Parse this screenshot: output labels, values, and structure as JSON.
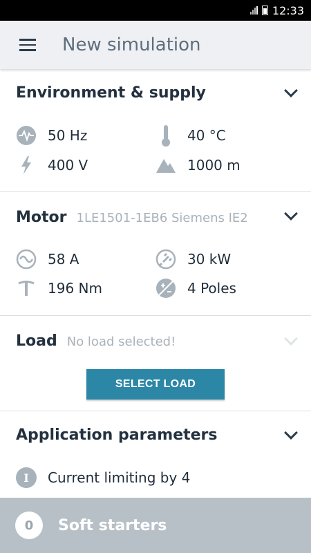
{
  "status_bar": {
    "time": "12:33"
  },
  "app_bar": {
    "title": "New simulation",
    "menu_icon": "hamburger-menu-icon"
  },
  "environment": {
    "title": "Environment & supply",
    "items": [
      {
        "icon": "frequency-icon",
        "value": "50 Hz"
      },
      {
        "icon": "thermometer-icon",
        "value": "40 °C"
      },
      {
        "icon": "voltage-bolt-icon",
        "value": "400 V"
      },
      {
        "icon": "altitude-mountain-icon",
        "value": "1000 m"
      }
    ]
  },
  "motor": {
    "title": "Motor",
    "subtitle": "1LE1501-1EB6 Siemens IE2",
    "items": [
      {
        "icon": "current-sine-icon",
        "value": "58 A"
      },
      {
        "icon": "power-plug-icon",
        "value": "30 kW"
      },
      {
        "icon": "torque-icon",
        "value": "196 Nm"
      },
      {
        "icon": "poles-icon",
        "value": "4 Poles"
      }
    ]
  },
  "load": {
    "title": "Load",
    "subtitle": "No load selected!",
    "button_label": "SELECT LOAD"
  },
  "application": {
    "title": "Application parameters",
    "items": [
      {
        "icon": "info-icon",
        "glyph": "I",
        "value": "Current limiting by 4"
      }
    ]
  },
  "bottom_bar": {
    "count": "0",
    "label": "Soft starters"
  },
  "colors": {
    "accent": "#2c86a6",
    "bottom_bar": "#b7c0c7",
    "app_bar": "#eef0f3",
    "icon_gray": "#a8b2bb"
  }
}
